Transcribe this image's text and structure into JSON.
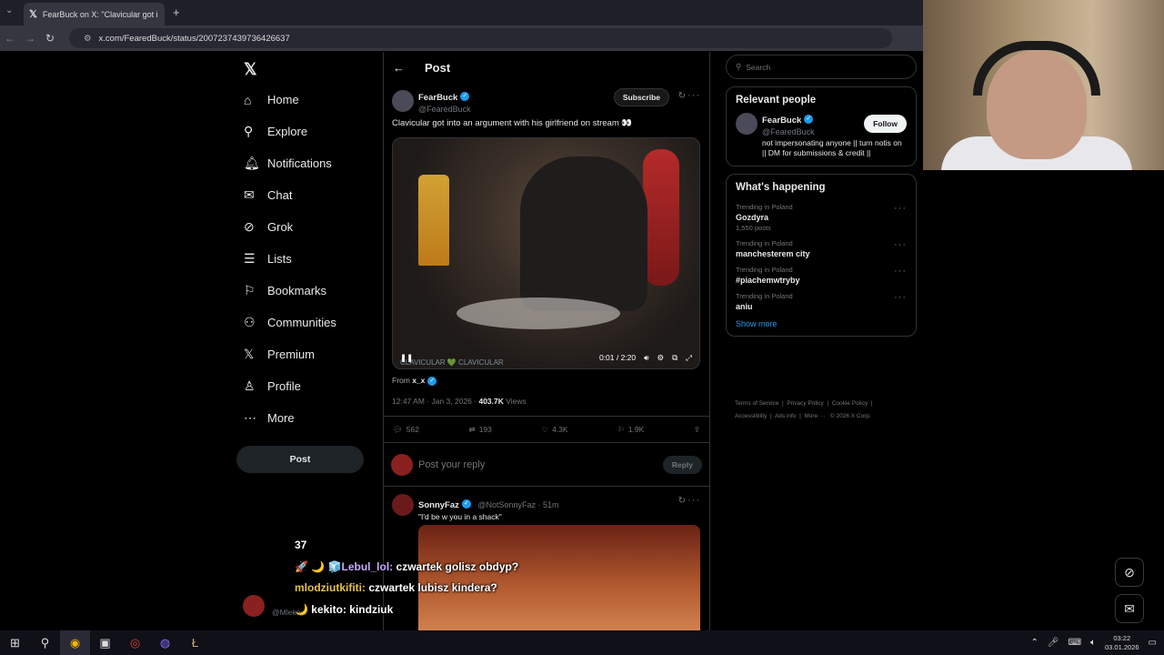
{
  "browser": {
    "tab_title": "FearBuck on X: \"Clavicular got i",
    "url": "x.com/FearedBuck/status/2007237439736426637"
  },
  "nav": {
    "items": [
      {
        "label": "Home",
        "icon": "home-icon"
      },
      {
        "label": "Explore",
        "icon": "search-icon"
      },
      {
        "label": "Notifications",
        "icon": "bell-icon"
      },
      {
        "label": "Chat",
        "icon": "mail-icon"
      },
      {
        "label": "Grok",
        "icon": "grok-icon"
      },
      {
        "label": "Lists",
        "icon": "list-icon"
      },
      {
        "label": "Bookmarks",
        "icon": "bookmark-icon"
      },
      {
        "label": "Communities",
        "icon": "people-icon"
      },
      {
        "label": "Premium",
        "icon": "x-icon"
      },
      {
        "label": "Profile",
        "icon": "person-icon"
      },
      {
        "label": "More",
        "icon": "more-icon"
      }
    ],
    "post_button": "Post"
  },
  "main": {
    "header_title": "Post",
    "post": {
      "author_name": "FearBuck",
      "author_handle": "@FearedBuck",
      "subscribe_label": "Subscribe",
      "text": "Clavicular got into an argument with his girlfriend on stream 👀",
      "video_time": "0:01 / 2:20",
      "watermark": "CLAVICULAR 💚 CLAVICULAR",
      "from_label": "From",
      "from_user": "x_x",
      "timestamp": "12:47 AM · Jan 3, 2026 ·",
      "views_count": "403.7K",
      "views_label": "Views",
      "replies": "562",
      "reposts": "193",
      "likes": "4.3K",
      "bookmarks": "1.9K"
    },
    "reply_placeholder": "Post your reply",
    "reply_button": "Reply",
    "reply1": {
      "name": "SonnyFaz",
      "handle": "@NotSonnyFaz · 51m",
      "text": "\"I'd be w you in a shack\""
    }
  },
  "right": {
    "search_placeholder": "Search",
    "relevant_title": "Relevant people",
    "person_name": "FearBuck",
    "person_handle": "@FearedBuck",
    "follow_label": "Follow",
    "person_bio": "not impersonating anyone || turn notis on || DM for submissions & credit ||",
    "happening_title": "What's happening",
    "trends": [
      {
        "category": "Trending in Poland",
        "name": "Gozdyra",
        "count": "1,550 posts"
      },
      {
        "category": "Trending in Poland",
        "name": "manchesterem city",
        "count": ""
      },
      {
        "category": "Trending in Poland",
        "name": "#piachemwtryby",
        "count": ""
      },
      {
        "category": "Trending in Poland",
        "name": "aniu",
        "count": ""
      }
    ],
    "show_more": "Show more",
    "footer": {
      "terms": "Terms of Service",
      "privacy": "Privacy Policy",
      "cookie": "Cookie Policy",
      "accessibility": "Accessibility",
      "ads": "Ads info",
      "more": "More ···",
      "copyright": "© 2026 X Corp."
    }
  },
  "overlay_chat": {
    "line0": "37",
    "line1_user": "🚀 🌙 🧊Lebul_lol:",
    "line1_msg": "czwartek golisz obdyp?",
    "line2_user": "mlodziutkifiti:",
    "line2_msg": "czwartek lubisz kindera?",
    "line3_user": "🌙 kekito:",
    "line3_msg": "kindziuk",
    "account_handle": "@Mleko..."
  },
  "taskbar": {
    "time": "03:22",
    "date": "03.01.2026"
  }
}
